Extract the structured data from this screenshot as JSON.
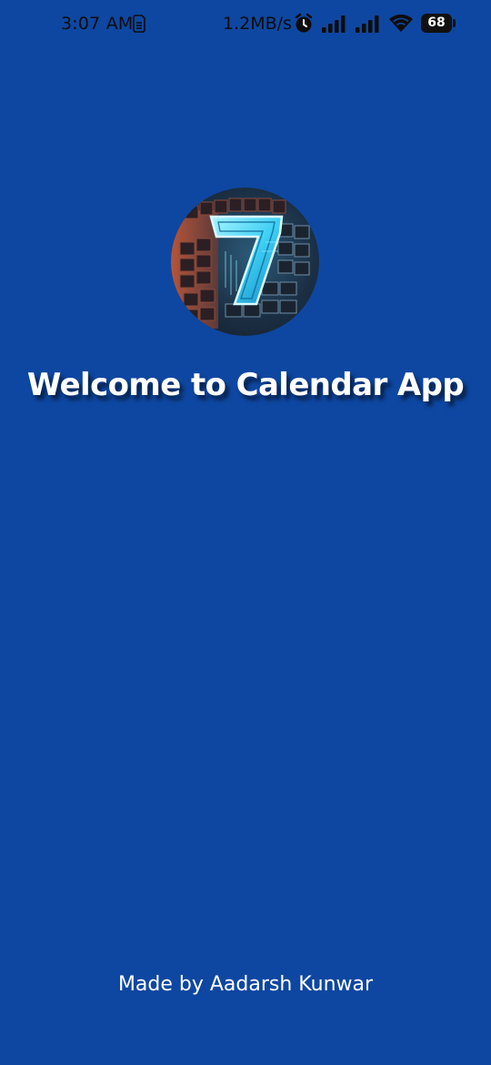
{
  "status_bar": {
    "time": "3:07 AM",
    "net_speed": "1.2MB/s",
    "battery_level": "68",
    "icons": [
      "sim-icon",
      "alarm-icon",
      "signal-icon",
      "signal-icon",
      "wifi-icon",
      "battery-icon"
    ]
  },
  "splash": {
    "logo_icon": "calendar-seven-logo",
    "title": "Welcome to Calendar App",
    "footer": "Made by Aadarsh Kunwar"
  },
  "colors": {
    "background": "#0E47A1",
    "text": "#FFFFFF",
    "status_text": "#0D0D0D"
  }
}
